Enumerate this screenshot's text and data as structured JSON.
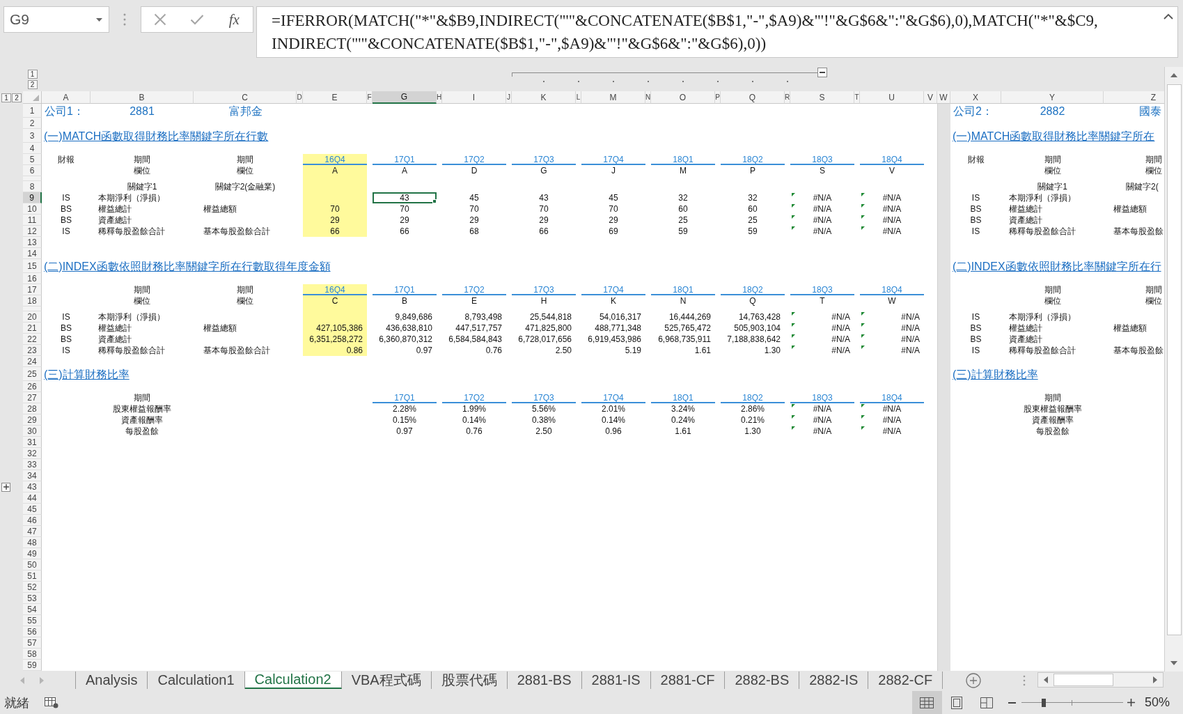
{
  "name_box": {
    "value": "G9"
  },
  "formula_bar": {
    "insert_function": "fx",
    "lines": [
      "=IFERROR(MATCH(\"*\"&$B9,INDIRECT(\"'\"&CONCATENATE($B$1,\"-\",$A9)&\"'!\"&G$6&\":\"&G$6),0),MATCH(\"*\"&$C9,",
      "INDIRECT(\"'\"&CONCATENATE($B$1,\"-\",$A9)&\"'!\"&G$6&\":\"&G$6),0))"
    ]
  },
  "outline": {
    "column_levels": [
      "1",
      "2"
    ],
    "row_levels": [
      "1",
      "2"
    ]
  },
  "columns": [
    {
      "label": "A",
      "selected": false
    },
    {
      "label": "B",
      "selected": false
    },
    {
      "label": "C",
      "selected": false
    },
    {
      "label": "D",
      "selected": false
    },
    {
      "label": "E",
      "selected": false
    },
    {
      "label": "F",
      "selected": false
    },
    {
      "label": "G",
      "selected": true
    },
    {
      "label": "H",
      "selected": false
    },
    {
      "label": "I",
      "selected": false
    },
    {
      "label": "J",
      "selected": false
    },
    {
      "label": "K",
      "selected": false
    },
    {
      "label": "L",
      "selected": false
    },
    {
      "label": "M",
      "selected": false
    },
    {
      "label": "N",
      "selected": false
    },
    {
      "label": "O",
      "selected": false
    },
    {
      "label": "P",
      "selected": false
    },
    {
      "label": "Q",
      "selected": false
    },
    {
      "label": "R",
      "selected": false
    },
    {
      "label": "S",
      "selected": false
    },
    {
      "label": "T",
      "selected": false
    },
    {
      "label": "U",
      "selected": false
    },
    {
      "label": "V",
      "selected": false
    },
    {
      "label": "W",
      "selected": false
    },
    {
      "label": "X",
      "selected": false
    },
    {
      "label": "Y",
      "selected": false
    },
    {
      "label": "Z",
      "selected": false
    }
  ],
  "rows": [
    {
      "label": "1",
      "kind": "title",
      "selected": false,
      "group_toggle": false
    },
    {
      "label": "2",
      "kind": "normal",
      "selected": false,
      "group_toggle": false
    },
    {
      "label": "3",
      "kind": "title",
      "selected": false,
      "group_toggle": false
    },
    {
      "label": "4",
      "kind": "normal",
      "selected": false,
      "group_toggle": false
    },
    {
      "label": "5",
      "kind": "normal",
      "selected": false,
      "group_toggle": false
    },
    {
      "label": "6",
      "kind": "normal",
      "selected": false,
      "group_toggle": false
    },
    {
      "kind": "thin",
      "selected": false,
      "group_toggle": false
    },
    {
      "label": "8",
      "kind": "normal",
      "selected": false,
      "group_toggle": false
    },
    {
      "label": "9",
      "kind": "normal",
      "selected": true,
      "group_toggle": false
    },
    {
      "label": "10",
      "kind": "normal",
      "selected": false,
      "group_toggle": false
    },
    {
      "label": "11",
      "kind": "normal",
      "selected": false,
      "group_toggle": false
    },
    {
      "label": "12",
      "kind": "normal",
      "selected": false,
      "group_toggle": false
    },
    {
      "label": "13",
      "kind": "normal",
      "selected": false,
      "group_toggle": false
    },
    {
      "label": "14",
      "kind": "normal",
      "selected": false,
      "group_toggle": false
    },
    {
      "label": "15",
      "kind": "title",
      "selected": false,
      "group_toggle": false
    },
    {
      "label": "16",
      "kind": "normal",
      "selected": false,
      "group_toggle": false
    },
    {
      "label": "17",
      "kind": "normal",
      "selected": false,
      "group_toggle": false
    },
    {
      "label": "18",
      "kind": "normal",
      "selected": false,
      "group_toggle": false
    },
    {
      "kind": "thin",
      "selected": false,
      "group_toggle": false
    },
    {
      "label": "20",
      "kind": "normal",
      "selected": false,
      "group_toggle": false
    },
    {
      "label": "21",
      "kind": "normal",
      "selected": false,
      "group_toggle": false
    },
    {
      "label": "22",
      "kind": "normal",
      "selected": false,
      "group_toggle": false
    },
    {
      "label": "23",
      "kind": "normal",
      "selected": false,
      "group_toggle": false
    },
    {
      "label": "24",
      "kind": "normal",
      "selected": false,
      "group_toggle": false
    },
    {
      "label": "25",
      "kind": "title",
      "selected": false,
      "group_toggle": false
    },
    {
      "label": "26",
      "kind": "normal",
      "selected": false,
      "group_toggle": false
    },
    {
      "label": "27",
      "kind": "normal",
      "selected": false,
      "group_toggle": false
    },
    {
      "label": "28",
      "kind": "normal",
      "selected": false,
      "group_toggle": false
    },
    {
      "label": "29",
      "kind": "normal",
      "selected": false,
      "group_toggle": false
    },
    {
      "label": "30",
      "kind": "normal",
      "selected": false,
      "group_toggle": false
    },
    {
      "label": "31",
      "kind": "normal",
      "selected": false,
      "group_toggle": false
    },
    {
      "label": "32",
      "kind": "normal",
      "selected": false,
      "group_toggle": false
    },
    {
      "label": "33",
      "kind": "normal",
      "selected": false,
      "group_toggle": false
    },
    {
      "label": "34",
      "kind": "normal",
      "selected": false,
      "group_toggle": false
    },
    {
      "label": "43",
      "kind": "normal",
      "selected": false,
      "group_toggle": true
    },
    {
      "label": "44",
      "kind": "normal",
      "selected": false,
      "group_toggle": false
    },
    {
      "label": "45",
      "kind": "normal",
      "selected": false,
      "group_toggle": false
    },
    {
      "label": "46",
      "kind": "normal",
      "selected": false,
      "group_toggle": false
    },
    {
      "label": "47",
      "kind": "normal",
      "selected": false,
      "group_toggle": false
    },
    {
      "label": "48",
      "kind": "normal",
      "selected": false,
      "group_toggle": false
    },
    {
      "label": "49",
      "kind": "normal",
      "selected": false,
      "group_toggle": false
    },
    {
      "label": "50",
      "kind": "normal",
      "selected": false,
      "group_toggle": false
    },
    {
      "label": "51",
      "kind": "normal",
      "selected": false,
      "group_toggle": false
    },
    {
      "label": "52",
      "kind": "normal",
      "selected": false,
      "group_toggle": false
    },
    {
      "label": "53",
      "kind": "normal",
      "selected": false,
      "group_toggle": false
    },
    {
      "label": "54",
      "kind": "normal",
      "selected": false,
      "group_toggle": false
    },
    {
      "label": "55",
      "kind": "normal",
      "selected": false,
      "group_toggle": false
    },
    {
      "label": "56",
      "kind": "normal",
      "selected": false,
      "group_toggle": false
    },
    {
      "label": "57",
      "kind": "normal",
      "selected": false,
      "group_toggle": false
    },
    {
      "label": "58",
      "kind": "normal",
      "selected": false,
      "group_toggle": false
    },
    {
      "label": "59",
      "kind": "normal",
      "selected": false,
      "group_toggle": false
    }
  ],
  "company_1": {
    "label": "公司1：",
    "code": "2881",
    "name": "富邦金",
    "match_section": {
      "heading": "(一)MATCH函數取得財務比率關鍵字所在行數",
      "statement_header": "財報",
      "period_headers": [
        "期間",
        "期間"
      ],
      "field_headers": [
        "欄位",
        "欄位"
      ],
      "keyword_headers": [
        "關鍵字1",
        "關鍵字2(金融業)"
      ],
      "periods": [
        {
          "label": "16Q4",
          "field": "A",
          "highlighted": true,
          "error_marks": false
        },
        {
          "label": "17Q1",
          "field": "A",
          "highlighted": false,
          "error_marks": false
        },
        {
          "label": "17Q2",
          "field": "D",
          "highlighted": false,
          "error_marks": false
        },
        {
          "label": "17Q3",
          "field": "G",
          "highlighted": false,
          "error_marks": false
        },
        {
          "label": "17Q4",
          "field": "J",
          "highlighted": false,
          "error_marks": false
        },
        {
          "label": "18Q1",
          "field": "M",
          "highlighted": false,
          "error_marks": false
        },
        {
          "label": "18Q2",
          "field": "P",
          "highlighted": false,
          "error_marks": false
        },
        {
          "label": "18Q3",
          "field": "S",
          "highlighted": false,
          "error_marks": true
        },
        {
          "label": "18Q4",
          "field": "V",
          "highlighted": false,
          "error_marks": true
        }
      ],
      "rows": [
        {
          "statement": "IS",
          "keyword_1": "本期淨利（淨損）",
          "values": [
            "43",
            "45",
            "43",
            "45",
            "32",
            "32",
            "#N/A",
            "#N/A"
          ]
        },
        {
          "statement": "BS",
          "keyword_1": "權益總計",
          "keyword_2": "權益總額",
          "values": [
            "70",
            "70",
            "70",
            "70",
            "70",
            "60",
            "60",
            "#N/A",
            "#N/A"
          ]
        },
        {
          "statement": "BS",
          "keyword_1": "資產總計",
          "values": [
            "29",
            "29",
            "29",
            "29",
            "29",
            "25",
            "25",
            "#N/A",
            "#N/A"
          ]
        },
        {
          "statement": "IS",
          "keyword_1": "稀釋每股盈餘合計",
          "keyword_2": "基本每股盈餘合計",
          "values": [
            "66",
            "66",
            "68",
            "66",
            "69",
            "59",
            "59",
            "#N/A",
            "#N/A"
          ]
        }
      ]
    },
    "index_section": {
      "heading": "(二)INDEX函數依照財務比率關鍵字所在行數取得年度金額",
      "period_headers": [
        "期間",
        "期間"
      ],
      "field_headers": [
        "欄位",
        "欄位"
      ],
      "periods": [
        {
          "label": "16Q4",
          "field": "C",
          "highlighted": true,
          "error_marks": false
        },
        {
          "label": "17Q1",
          "field": "B",
          "highlighted": false,
          "error_marks": false
        },
        {
          "label": "17Q2",
          "field": "E",
          "highlighted": false,
          "error_marks": false
        },
        {
          "label": "17Q3",
          "field": "H",
          "highlighted": false,
          "error_marks": false
        },
        {
          "label": "17Q4",
          "field": "K",
          "highlighted": false,
          "error_marks": false
        },
        {
          "label": "18Q1",
          "field": "N",
          "highlighted": false,
          "error_marks": false
        },
        {
          "label": "18Q2",
          "field": "Q",
          "highlighted": false,
          "error_marks": false
        },
        {
          "label": "18Q3",
          "field": "T",
          "highlighted": false,
          "error_marks": true
        },
        {
          "label": "18Q4",
          "field": "W",
          "highlighted": false,
          "error_marks": true
        }
      ],
      "rows": [
        {
          "statement": "IS",
          "keyword_1": "本期淨利（淨損）",
          "values": [
            "9,849,686",
            "8,793,498",
            "25,544,818",
            "54,016,317",
            "16,444,269",
            "14,763,428",
            "#N/A",
            "#N/A"
          ]
        },
        {
          "statement": "BS",
          "keyword_1": "權益總計",
          "keyword_2": "權益總額",
          "values": [
            "427,105,386",
            "436,638,810",
            "447,517,757",
            "471,825,800",
            "488,771,348",
            "525,765,472",
            "505,903,104",
            "#N/A",
            "#N/A"
          ]
        },
        {
          "statement": "BS",
          "keyword_1": "資產總計",
          "values": [
            "6,351,258,272",
            "6,360,870,312",
            "6,584,584,843",
            "6,728,017,656",
            "6,919,453,986",
            "6,968,735,911",
            "7,188,838,642",
            "#N/A",
            "#N/A"
          ]
        },
        {
          "statement": "IS",
          "keyword_1": "稀釋每股盈餘合計",
          "keyword_2": "基本每股盈餘合計",
          "values": [
            "0.86",
            "0.97",
            "0.76",
            "2.50",
            "5.19",
            "1.61",
            "1.30",
            "#N/A",
            "#N/A"
          ]
        }
      ]
    },
    "ratio_section": {
      "heading": "(三)計算財務比率",
      "period_header": "期間",
      "periods": [
        {
          "label": "17Q1",
          "error_marks": false
        },
        {
          "label": "17Q2",
          "error_marks": false
        },
        {
          "label": "17Q3",
          "error_marks": false
        },
        {
          "label": "17Q4",
          "error_marks": false
        },
        {
          "label": "18Q1",
          "error_marks": false
        },
        {
          "label": "18Q2",
          "error_marks": false
        },
        {
          "label": "18Q3",
          "error_marks": true
        },
        {
          "label": "18Q4",
          "error_marks": true
        }
      ],
      "rows": [
        {
          "label": "股東權益報酬率",
          "values": [
            "2.28%",
            "1.99%",
            "5.56%",
            "2.01%",
            "3.24%",
            "2.86%",
            "#N/A",
            "#N/A"
          ]
        },
        {
          "label": "資產報酬率",
          "values": [
            "0.15%",
            "0.14%",
            "0.38%",
            "0.14%",
            "0.24%",
            "0.21%",
            "#N/A",
            "#N/A"
          ]
        },
        {
          "label": "每股盈餘",
          "values": [
            "0.97",
            "0.76",
            "2.50",
            "0.96",
            "1.61",
            "1.30",
            "#N/A",
            "#N/A"
          ]
        }
      ]
    }
  },
  "company_2": {
    "label": "公司2：",
    "code": "2882",
    "name": "國泰",
    "match_section": {
      "heading": "(一)MATCH函數取得財務比率關鍵字所在",
      "statement_header": "財報",
      "period_headers": [
        "期間",
        "期間"
      ],
      "field_headers": [
        "欄位",
        "欄位"
      ],
      "keyword_headers": [
        "關鍵字1",
        "關鍵字2("
      ],
      "rows": [
        {
          "statement": "IS",
          "keyword_1": "本期淨利（淨損）"
        },
        {
          "statement": "BS",
          "keyword_1": "權益總計",
          "keyword_2": "權益總額"
        },
        {
          "statement": "BS",
          "keyword_1": "資產總計"
        },
        {
          "statement": "IS",
          "keyword_1": "稀釋每股盈餘合計",
          "keyword_2": "基本每股盈餘"
        }
      ]
    },
    "index_section": {
      "heading": "(二)INDEX函數依照財務比率關鍵字所在行",
      "period_headers": [
        "期間",
        "期間"
      ],
      "field_headers": [
        "欄位",
        "欄位"
      ],
      "rows": [
        {
          "statement": "IS",
          "keyword_1": "本期淨利（淨損）"
        },
        {
          "statement": "BS",
          "keyword_1": "權益總計",
          "keyword_2": "權益總額"
        },
        {
          "statement": "BS",
          "keyword_1": "資產總計"
        },
        {
          "statement": "IS",
          "keyword_1": "稀釋每股盈餘合計",
          "keyword_2": "基本每股盈餘"
        }
      ]
    },
    "ratio_section": {
      "heading": "(三)計算財務比率",
      "period_header": "期間",
      "rows": [
        {
          "label": "股東權益報酬率"
        },
        {
          "label": "資產報酬率"
        },
        {
          "label": "每股盈餘"
        }
      ]
    }
  },
  "sheet_tabs": [
    {
      "label": "Analysis",
      "selected": false
    },
    {
      "label": "Calculation1",
      "selected": false
    },
    {
      "label": "Calculation2",
      "selected": true
    },
    {
      "label": "VBA程式碼",
      "selected": false
    },
    {
      "label": "股票代碼",
      "selected": false
    },
    {
      "label": "2881-BS",
      "selected": false
    },
    {
      "label": "2881-IS",
      "selected": false
    },
    {
      "label": "2881-CF",
      "selected": false
    },
    {
      "label": "2882-BS",
      "selected": false
    },
    {
      "label": "2882-IS",
      "selected": false
    },
    {
      "label": "2882-CF",
      "selected": false
    }
  ],
  "status_bar": {
    "status": "就緒",
    "views": [
      {
        "kind": "normal",
        "selected": true
      },
      {
        "kind": "page_layout",
        "selected": false
      },
      {
        "kind": "page_break",
        "selected": false
      }
    ],
    "zoom": {
      "label": "50%",
      "level": 0.22
    }
  }
}
